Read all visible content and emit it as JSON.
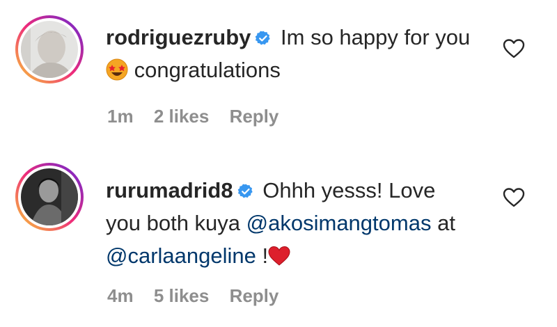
{
  "comments": [
    {
      "username": "rodriguezruby",
      "verified": true,
      "text_before_emoji": "Im so happy for you",
      "emoji": "star-struck-emoji",
      "text_after_emoji": " congratulations",
      "time": "1m",
      "likes": "2 likes",
      "reply": "Reply"
    },
    {
      "username": "rurumadrid8",
      "verified": true,
      "text_part1": "Ohhh yesss! Love you both kuya",
      "mention1": "@akosimangtomas",
      "text_part2": "at",
      "mention2": "@carlaangeline",
      "text_part3": "!",
      "emoji": "red-heart-emoji",
      "time": "4m",
      "likes": "5 likes",
      "reply": "Reply"
    }
  ],
  "colors": {
    "text": "#262626",
    "meta": "#8e8e8e",
    "mention": "#00376b",
    "verified": "#3897f0"
  }
}
